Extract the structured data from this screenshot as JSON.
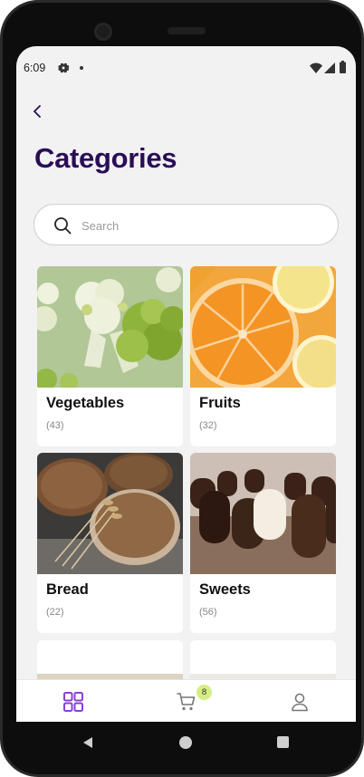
{
  "statusbar": {
    "time": "6:09",
    "icons": [
      "gear-icon",
      "dot-icon",
      "wifi-icon",
      "signal-icon",
      "battery-icon"
    ]
  },
  "header": {
    "back_icon": "chevron-left-icon",
    "title": "Categories"
  },
  "search": {
    "placeholder": "Search",
    "value": "",
    "icon": "search-icon"
  },
  "categories": [
    {
      "name": "Vegetables",
      "count": "(43)",
      "image": "cauliflower"
    },
    {
      "name": "Fruits",
      "count": "(32)",
      "image": "oranges-lemons"
    },
    {
      "name": "Bread",
      "count": "(22)",
      "image": "bread-loaves"
    },
    {
      "name": "Sweets",
      "count": "(56)",
      "image": "chocolate-marshmallows"
    },
    {
      "name": "",
      "count": "",
      "image": "partial-pasta"
    },
    {
      "name": "",
      "count": "",
      "image": "partial-jar"
    }
  ],
  "bottom_nav": {
    "items": [
      {
        "icon": "grid-icon",
        "active": true
      },
      {
        "icon": "cart-icon",
        "badge": "8",
        "active": false
      },
      {
        "icon": "profile-icon",
        "active": false
      }
    ]
  },
  "colors": {
    "title": "#2a0e55",
    "accent": "#8a3fd6",
    "badge": "#d5ee84",
    "background": "#f2f2f3"
  }
}
